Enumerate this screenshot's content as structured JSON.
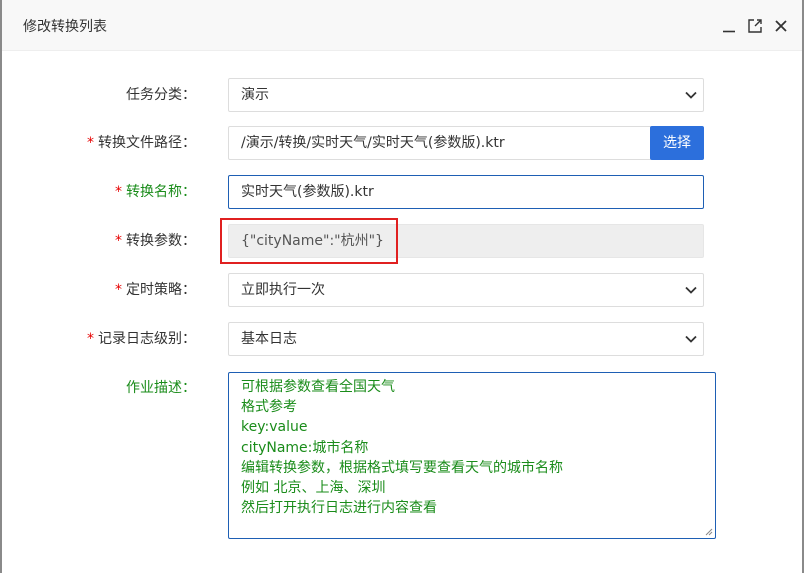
{
  "dialog": {
    "title": "修改转换列表"
  },
  "form": {
    "category": {
      "label": "任务分类：",
      "value": "演示",
      "required": false
    },
    "file_path": {
      "label": "转换文件路径：",
      "value": "/演示/转换/实时天气/实时天气(参数版).ktr",
      "browse_label": "选择",
      "required": true
    },
    "name": {
      "label": "转换名称：",
      "value": "实时天气(参数版).ktr",
      "required": true
    },
    "params": {
      "label": "转换参数：",
      "value": "{\"cityName\":\"杭州\"}",
      "required": true
    },
    "schedule": {
      "label": "定时策略：",
      "value": "立即执行一次",
      "required": true
    },
    "log_level": {
      "label": "记录日志级别：",
      "value": "基本日志",
      "required": true
    },
    "description": {
      "label": "作业描述：",
      "lines": [
        "可根据参数查看全国天气",
        "格式参考",
        "key:value",
        "cityName:城市名称",
        "编辑转换参数，根据格式填写要查看天气的城市名称",
        "例如 北京、上海、深圳",
        "然后打开执行日志进行内容查看"
      ]
    },
    "required_mark": "*"
  },
  "colors": {
    "accent": "#2c6fdc",
    "focus_border": "#1e5fb4",
    "label_green": "#1a8c1a",
    "required_red": "#e60000",
    "highlight_red": "#e02020"
  }
}
